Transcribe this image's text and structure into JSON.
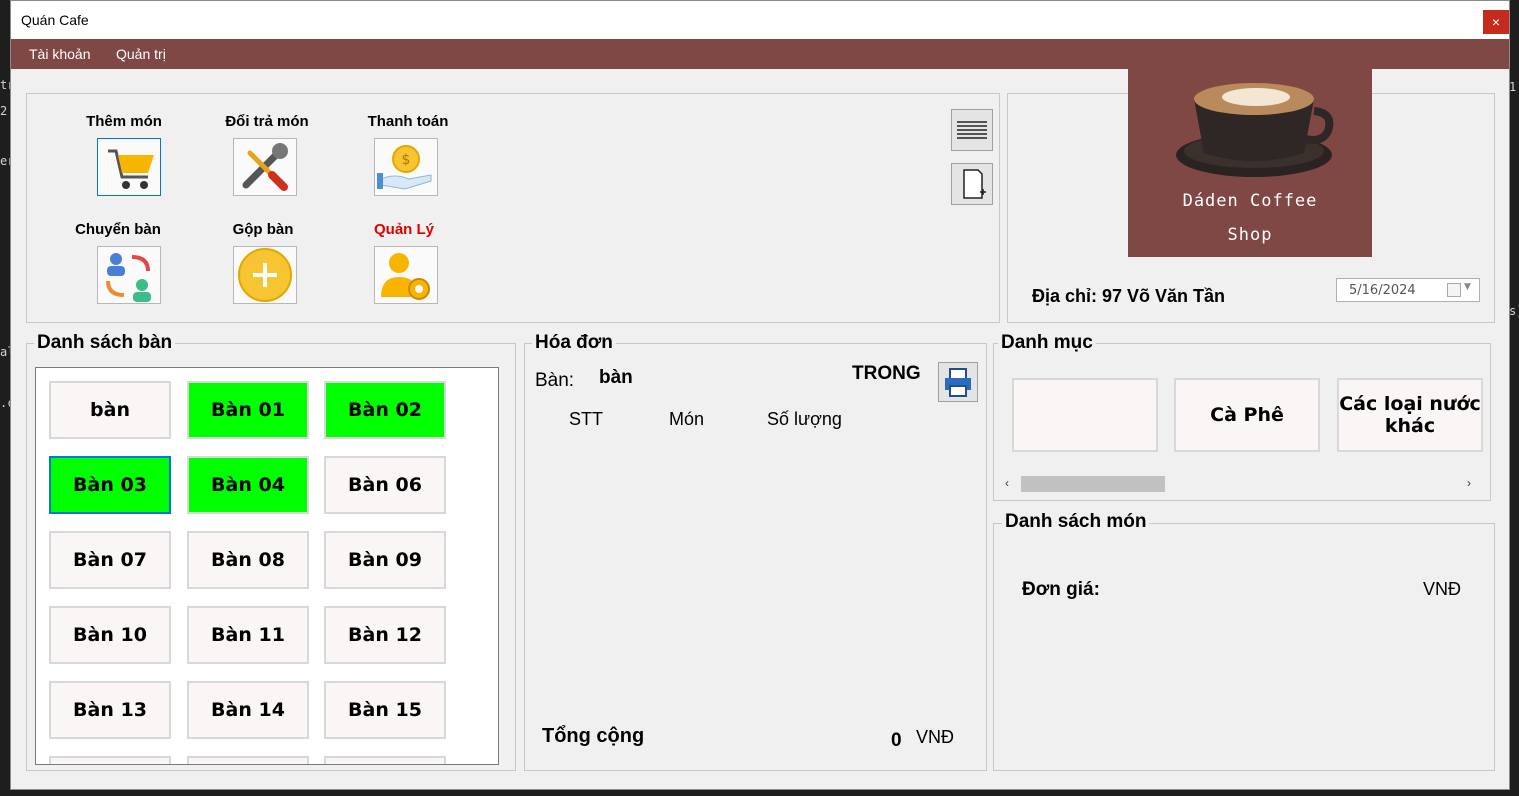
{
  "window": {
    "title": "Quán Cafe",
    "close": "×"
  },
  "menu": {
    "items": [
      "Tài khoản",
      "Quản trị"
    ]
  },
  "functions": [
    {
      "label": "Thêm món",
      "icon": "shopping-cart-icon"
    },
    {
      "label": "Đổi trả món",
      "icon": "tools-icon"
    },
    {
      "label": "Thanh toán",
      "icon": "coin-hand-icon"
    },
    {
      "label": "Chuyển bàn",
      "icon": "swap-people-icon"
    },
    {
      "label": "Gộp bàn",
      "icon": "plus-circle-icon"
    },
    {
      "label": "Quản Lý",
      "icon": "user-gear-icon"
    }
  ],
  "side_buttons": [
    "list-icon",
    "new-page-icon"
  ],
  "shop": {
    "name": "Dáden Coffee",
    "sub": "Shop",
    "address": "Địa chỉ: 97 Võ Văn Tần",
    "date": "5/16/2024"
  },
  "tables": {
    "title": "Danh sách bàn",
    "items": [
      {
        "label": "bàn",
        "status": "free"
      },
      {
        "label": "Bàn 01",
        "status": "busy"
      },
      {
        "label": "Bàn 02",
        "status": "busy"
      },
      {
        "label": "Bàn 03",
        "status": "busy",
        "selected": true
      },
      {
        "label": "Bàn 04",
        "status": "busy"
      },
      {
        "label": "Bàn 06",
        "status": "free"
      },
      {
        "label": "Bàn 07",
        "status": "free"
      },
      {
        "label": "Bàn 08",
        "status": "free"
      },
      {
        "label": "Bàn 09",
        "status": "free"
      },
      {
        "label": "Bàn 10",
        "status": "free"
      },
      {
        "label": "Bàn 11",
        "status": "free"
      },
      {
        "label": "Bàn 12",
        "status": "free"
      },
      {
        "label": "Bàn 13",
        "status": "free"
      },
      {
        "label": "Bàn 14",
        "status": "free"
      },
      {
        "label": "Bàn 15",
        "status": "free"
      }
    ]
  },
  "invoice": {
    "title": "Hóa đơn",
    "table_label": "Bàn:",
    "table_value": "bàn",
    "status": "TRONG",
    "columns": [
      "STT",
      "Món",
      "Số lượng"
    ],
    "total_label": "Tổng cộng",
    "total_value": "0",
    "currency": "VNĐ"
  },
  "categories": {
    "title": "Danh mục",
    "items": [
      "",
      "Cà Phê",
      "Các loại nước khác"
    ]
  },
  "menu_list": {
    "title": "Danh sách món",
    "price_label": "Đơn giá:",
    "currency": "VNĐ"
  },
  "colors": {
    "brand": "#7f4844",
    "busy": "#00ff00",
    "accent": "#0078d7",
    "manage": "#e00000"
  }
}
